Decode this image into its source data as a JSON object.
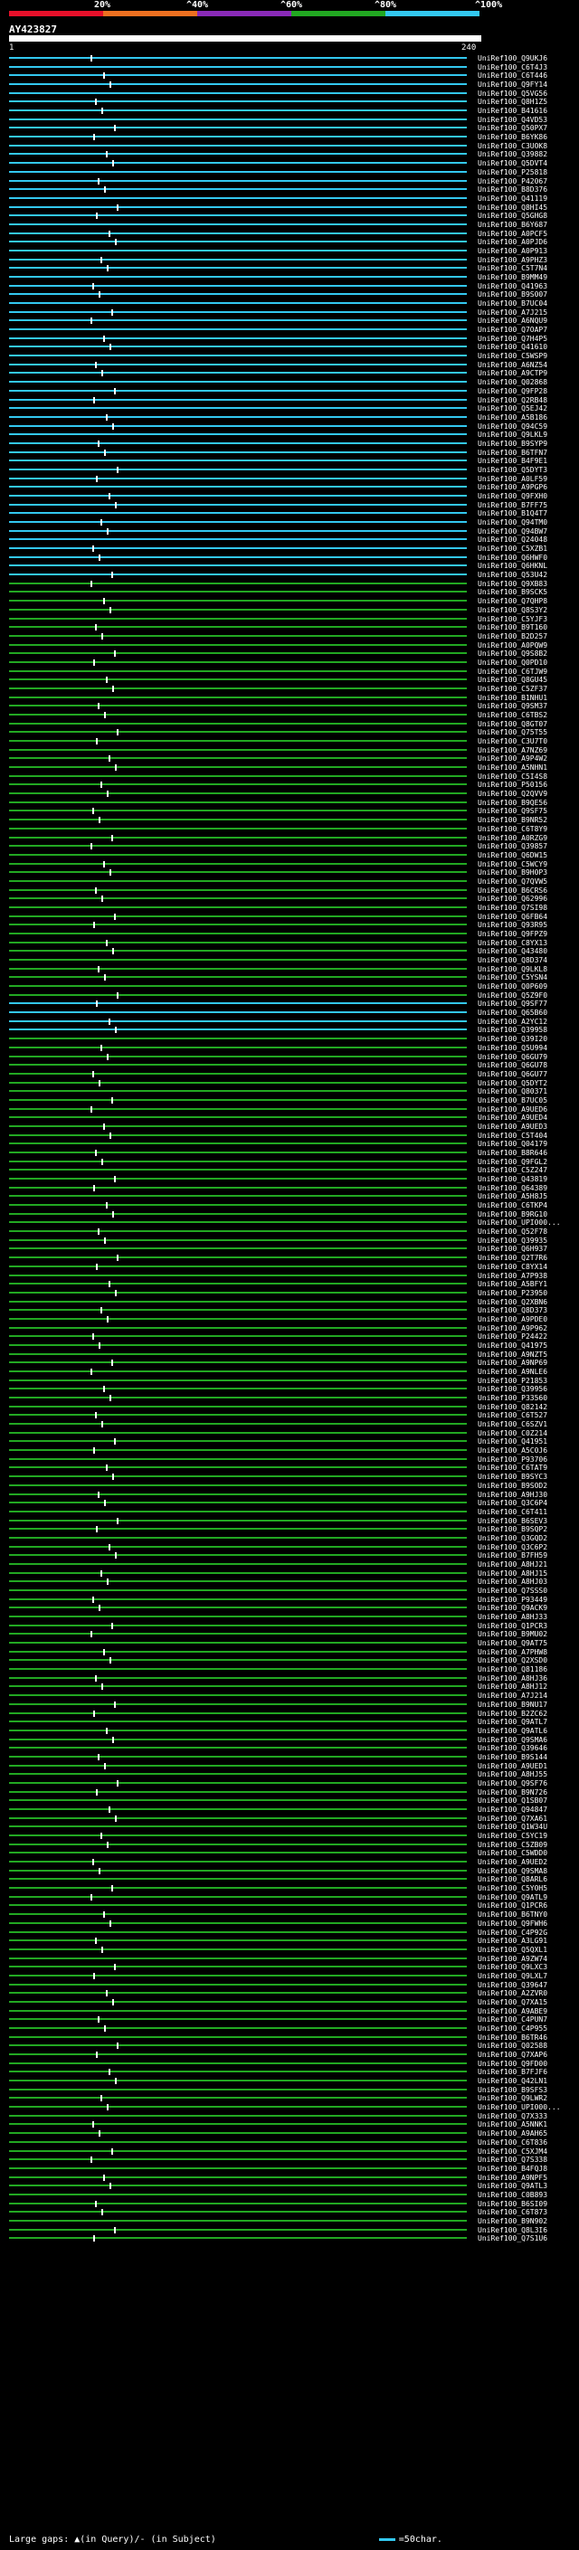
{
  "scale": {
    "labels": [
      "20%",
      "^40%",
      "^60%",
      "^80%",
      "^100%"
    ],
    "colors": [
      "#e8102a",
      "#ee7020",
      "#8a2ab8",
      "#22a822",
      "#33c8f0"
    ]
  },
  "query": {
    "id": "AY423827",
    "start": "1",
    "end": "240"
  },
  "colors": {
    "cyan": "#33c8f0",
    "green": "#22a822",
    "gap": "#ffffff"
  },
  "hits": [
    "UniRef100_Q9UKJ6",
    "UniRef100_C6T4J3",
    "UniRef100_C6T446",
    "UniRef100_Q9FY14",
    "UniRef100_Q5VG56",
    "UniRef100_Q8H1Z5",
    "UniRef100_B41616",
    "UniRef100_Q4VD53",
    "UniRef100_Q50PX7",
    "UniRef100_B6YK86",
    "UniRef100_C3UOK8",
    "UniRef100_Q39882",
    "UniRef100_Q5DVT4",
    "UniRef100_P25818",
    "UniRef100_P42067",
    "UniRef100_B8D376",
    "UniRef100_Q41119",
    "UniRef100_Q8HI45",
    "UniRef100_Q5GHG8",
    "UniRef100_B6Y687",
    "UniRef100_A0PCF5",
    "UniRef100_A0PJD6",
    "UniRef100_A0P913",
    "UniRef100_A9PHZ3",
    "UniRef100_C5T7N4",
    "UniRef100_B9MM49",
    "UniRef100_Q41963",
    "UniRef100_B9S007",
    "UniRef100_B7UC04",
    "UniRef100_A7J215",
    "UniRef100_A6NQU9",
    "UniRef100_Q7OAP7",
    "UniRef100_Q7H4P5",
    "UniRef100_Q41610",
    "UniRef100_C5WSP9",
    "UniRef100_A6NZ54",
    "UniRef100_A9CTP9",
    "UniRef100_Q02868",
    "UniRef100_Q9FP28",
    "UniRef100_Q2RB48",
    "UniRef100_Q5EJ42",
    "UniRef100_A5B186",
    "UniRef100_Q94C59",
    "UniRef100_Q9LKL9",
    "UniRef100_B9SYP9",
    "UniRef100_B6TFN7",
    "UniRef100_B4F9E1",
    "UniRef100_Q5DYT3",
    "UniRef100_A0LF59",
    "UniRef100_A9PGP6",
    "UniRef100_Q9FXH0",
    "UniRef100_B7FF75",
    "UniRef100_B1Q4T7",
    "UniRef100_Q94TM0",
    "UniRef100_Q94BW7",
    "UniRef100_Q24048",
    "UniRef100_C5XZB1",
    "UniRef100_Q6HWF0",
    "UniRef100_Q6HKNL",
    "UniRef100_Q53U42",
    "UniRef100_Q9XB83",
    "UniRef100_B9SCK5",
    "UniRef100_Q7QHP8",
    "UniRef100_Q8S3Y2",
    "UniRef100_C5YJF3",
    "UniRef100_B9T160",
    "UniRef100_B2D257",
    "UniRef100_A0PQW9",
    "UniRef100_Q9S8B2",
    "UniRef100_Q0PD10",
    "UniRef100_C6TJW9",
    "UniRef100_Q8GU45",
    "UniRef100_C5ZF37",
    "UniRef100_B1NHU1",
    "UniRef100_Q9SM37",
    "UniRef100_C6TBS2",
    "UniRef100_Q8GT07",
    "UniRef100_Q75T55",
    "UniRef100_C3U7T0",
    "UniRef100_A7NZ69",
    "UniRef100_A9P4W2",
    "UniRef100_A5NHN1",
    "UniRef100_C5I4S8",
    "UniRef100_P50156",
    "UniRef100_Q2QVV9",
    "UniRef100_B9QE56",
    "UniRef100_Q9SF75",
    "UniRef100_B9NR52",
    "UniRef100_C6T8Y9",
    "UniRef100_A0RZG9",
    "UniRef100_Q39857",
    "UniRef100_Q6DW15",
    "UniRef100_C5WCY9",
    "UniRef100_B9H0P3",
    "UniRef100_Q7QVW5",
    "UniRef100_B6CRS6",
    "UniRef100_Q62996",
    "UniRef100_Q7SI98",
    "UniRef100_Q6FB64",
    "UniRef100_Q93R95",
    "UniRef100_Q9FPZ9",
    "UniRef100_C8YX13",
    "UniRef100_Q43480",
    "UniRef100_Q8D374",
    "UniRef100_Q9LKL8",
    "UniRef100_C5YSN4",
    "UniRef100_Q0P609",
    "UniRef100_Q5Z9F0",
    "UniRef100_Q9SF77",
    "UniRef100_Q65B60",
    "UniRef100_A2YC12",
    "UniRef100_Q39958",
    "UniRef100_Q39I20",
    "UniRef100_Q5U994",
    "UniRef100_Q6GU79",
    "UniRef100_Q6GU78",
    "UniRef100_Q6GU77",
    "UniRef100_Q5DYT2",
    "UniRef100_Q80371",
    "UniRef100_B7UC05",
    "UniRef100_A9UED6",
    "UniRef100_A9UED4",
    "UniRef100_A9UED3",
    "UniRef100_C5T404",
    "UniRef100_Q04179",
    "UniRef100_B8R646",
    "UniRef100_Q9FGL2",
    "UniRef100_C5Z247",
    "UniRef100_Q43819",
    "UniRef100_Q64389",
    "UniRef100_A5H8J5",
    "UniRef100_C6TKP4",
    "UniRef100_B9RG10",
    "UniRef100_UPI000...",
    "UniRef100_Q52F78",
    "UniRef100_Q39935",
    "UniRef100_Q6H937",
    "UniRef100_Q2T7R6",
    "UniRef100_C8YX14",
    "UniRef100_A7P938",
    "UniRef100_A5BFY1",
    "UniRef100_P23950",
    "UniRef100_Q2XBN6",
    "UniRef100_Q8D373",
    "UniRef100_A9PDE0",
    "UniRef100_A9P962",
    "UniRef100_P24422",
    "UniRef100_Q41975",
    "UniRef100_A9NZT5",
    "UniRef100_A9NP69",
    "UniRef100_A9NLE6",
    "UniRef100_P21853",
    "UniRef100_Q39956",
    "UniRef100_P33560",
    "UniRef100_Q82142",
    "UniRef100_C6T527",
    "UniRef100_C6SZV1",
    "UniRef100_C0Z214",
    "UniRef100_Q41951",
    "UniRef100_A5C0J6",
    "UniRef100_P93706",
    "UniRef100_C6TAT9",
    "UniRef100_B9SYC3",
    "UniRef100_B9SOD2",
    "UniRef100_A9HJ30",
    "UniRef100_Q3C6P4",
    "UniRef100_C6T411",
    "UniRef100_B6SEV3",
    "UniRef100_B9SQP2",
    "UniRef100_Q3GQD2",
    "UniRef100_Q3C6P2",
    "UniRef100_B7FH59",
    "UniRef100_A8HJ21",
    "UniRef100_A8HJ15",
    "UniRef100_A8HJ03",
    "UniRef100_Q7SSS0",
    "UniRef100_P93449",
    "UniRef100_Q9ACK9",
    "UniRef100_A8HJ33",
    "UniRef100_Q1PCR3",
    "UniRef100_B9MU02",
    "UniRef100_Q9AT75",
    "UniRef100_A7PHW8",
    "UniRef100_Q2XSD0",
    "UniRef100_Q81186",
    "UniRef100_A8HJ36",
    "UniRef100_A8HJ12",
    "UniRef100_A7J214",
    "UniRef100_B9NU17",
    "UniRef100_B2ZC62",
    "UniRef100_Q9ATL7",
    "UniRef100_Q9ATL6",
    "UniRef100_Q9SMA6",
    "UniRef100_Q39646",
    "UniRef100_B9S144",
    "UniRef100_A9UED1",
    "UniRef100_A8HJ55",
    "UniRef100_Q9SF76",
    "UniRef100_B9N726",
    "UniRef100_Q1SB07",
    "UniRef100_Q94847",
    "UniRef100_Q7XA61",
    "UniRef100_Q1W34U",
    "UniRef100_C5YC19",
    "UniRef100_C5ZB09",
    "UniRef100_C5WDD0",
    "UniRef100_A9UED2",
    "UniRef100_Q9SMA8",
    "UniRef100_Q8ARL6",
    "UniRef100_C5YOH5",
    "UniRef100_Q9ATL9",
    "UniRef100_Q1PCR6",
    "UniRef100_B6TNY0",
    "UniRef100_Q9FWH6",
    "UniRef100_C4P92G",
    "UniRef100_A3LG91",
    "UniRef100_Q5QXL1",
    "UniRef100_A9ZW74",
    "UniRef100_Q9LXC3",
    "UniRef100_Q9LXL7",
    "UniRef100_Q39647",
    "UniRef100_A2ZVR0",
    "UniRef100_Q7XA15",
    "UniRef100_A9ABE9",
    "UniRef100_C4PUN7",
    "UniRef100_C4P955",
    "UniRef100_B6TR46",
    "UniRef100_Q02588",
    "UniRef100_Q7XAP6",
    "UniRef100_Q9FD00",
    "UniRef100_B7FJF6",
    "UniRef100_Q42LN1",
    "UniRef100_B9SFS3",
    "UniRef100_Q9LWR2",
    "UniRef100_UPI000...",
    "UniRef100_Q7X333",
    "UniRef100_A5NNK1",
    "UniRef100_A9AH65",
    "UniRef100_C6T836",
    "UniRef100_C5XJM4",
    "UniRef100_Q7S338",
    "UniRef100_B4FQJ8",
    "UniRef100_A9NPF5",
    "UniRef100_Q9ATL3",
    "UniRef100_C0B893",
    "UniRef100_B6SI09",
    "UniRef100_C6T873",
    "UniRef100_B9N902",
    "UniRef100_Q8L3I6",
    "UniRef100_Q7S1U6"
  ],
  "legend": {
    "gaps": "Large gaps: ▲(in Query)/- (in Subject)",
    "scale": "=50char."
  }
}
